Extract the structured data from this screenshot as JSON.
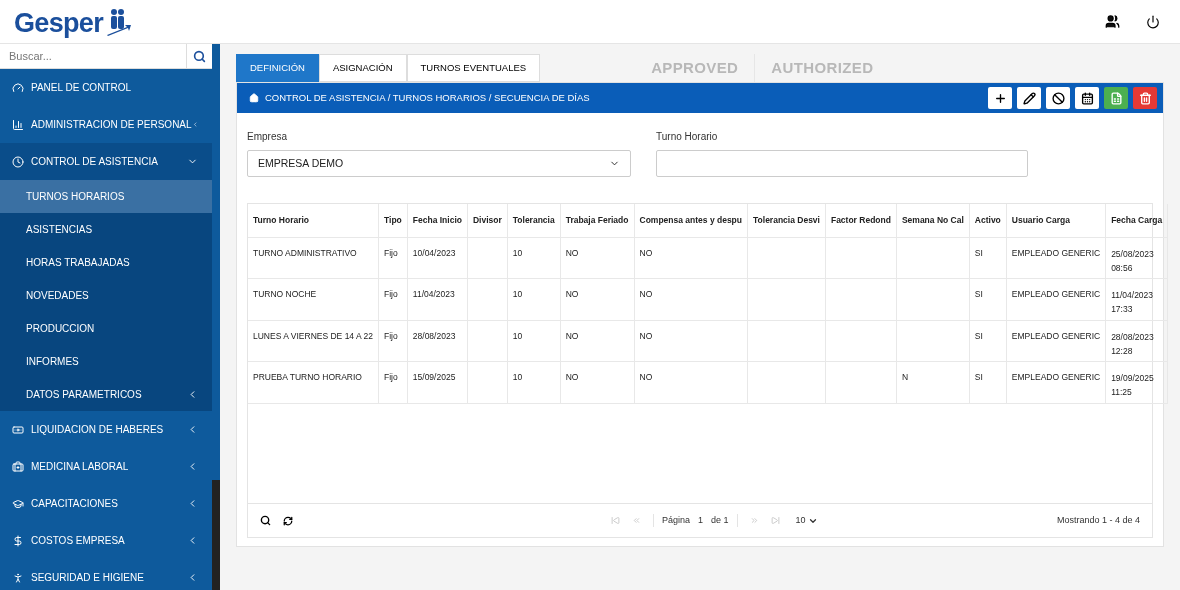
{
  "header": {
    "logo": "Gesper"
  },
  "sidebar": {
    "search": {
      "placeholder": "Buscar..."
    },
    "items": [
      {
        "label": "PANEL DE CONTROL",
        "has_children": false,
        "expanded": false
      },
      {
        "label": "ADMINISTRACION DE PERSONAL",
        "has_children": true,
        "expanded": false
      },
      {
        "label": "CONTROL DE ASISTENCIA",
        "has_children": true,
        "expanded": true,
        "children": [
          {
            "label": "TURNOS HORARIOS",
            "selected": true,
            "has_children": false
          },
          {
            "label": "ASISTENCIAS",
            "selected": false,
            "has_children": false
          },
          {
            "label": "HORAS TRABAJADAS",
            "selected": false,
            "has_children": false
          },
          {
            "label": "NOVEDADES",
            "selected": false,
            "has_children": false
          },
          {
            "label": "PRODUCCION",
            "selected": false,
            "has_children": false
          },
          {
            "label": "INFORMES",
            "selected": false,
            "has_children": false
          },
          {
            "label": "DATOS PARAMETRICOS",
            "selected": false,
            "has_children": true
          }
        ]
      },
      {
        "label": "LIQUIDACION DE HABERES",
        "has_children": true,
        "expanded": false
      },
      {
        "label": "MEDICINA LABORAL",
        "has_children": true,
        "expanded": false
      },
      {
        "label": "CAPACITACIONES",
        "has_children": true,
        "expanded": false
      },
      {
        "label": "COSTOS EMPRESA",
        "has_children": true,
        "expanded": false
      },
      {
        "label": "SEGURIDAD E HIGIENE",
        "has_children": true,
        "expanded": false
      }
    ]
  },
  "tabs": [
    {
      "label": "DEFINICIÓN",
      "selected": true
    },
    {
      "label": "ASIGNACIÓN",
      "selected": false
    },
    {
      "label": "TURNOS EVENTUALES",
      "selected": false
    }
  ],
  "status_labels": [
    "APPROVED",
    "AUTHORIZED"
  ],
  "breadcrumb": "CONTROL DE ASISTENCIA / TURNOS HORARIOS / SECUENCIA DE DÍAS",
  "toolbar": [
    {
      "kind": "add"
    },
    {
      "kind": "edit"
    },
    {
      "kind": "disable"
    },
    {
      "kind": "calendar"
    },
    {
      "kind": "excel"
    },
    {
      "kind": "delete"
    }
  ],
  "form": {
    "empresa": {
      "label": "Empresa",
      "value": "EMPRESA DEMO"
    },
    "turno_horario": {
      "label": "Turno Horario"
    }
  },
  "table": {
    "columns": [
      "Turno Horario",
      "Tipo",
      "Fecha Inicio",
      "Divisor",
      "Tolerancia",
      "Trabaja Feriado",
      "Compensa antes y despu",
      "Tolerancia Desvi",
      "Factor Redond",
      "Semana No Cal",
      "Activo",
      "Usuario Carga",
      "Fecha Carga"
    ],
    "rows": [
      [
        "TURNO ADMINISTRATIVO",
        "Fijo",
        "10/04/2023",
        "",
        "10",
        "NO",
        "NO",
        "",
        "",
        "",
        "SI",
        "EMPLEADO GENERIC",
        "25/08/2023 08:56"
      ],
      [
        "TURNO NOCHE",
        "Fijo",
        "11/04/2023",
        "",
        "10",
        "NO",
        "NO",
        "",
        "",
        "",
        "SI",
        "EMPLEADO GENERIC",
        "11/04/2023 17:33"
      ],
      [
        "LUNES A VIERNES DE 14 A 22",
        "Fijo",
        "28/08/2023",
        "",
        "10",
        "NO",
        "NO",
        "",
        "",
        "",
        "SI",
        "EMPLEADO GENERIC",
        "28/08/2023 12:28"
      ],
      [
        "PRUEBA TURNO HORARIO",
        "Fijo",
        "15/09/2025",
        "",
        "10",
        "NO",
        "NO",
        "",
        "",
        "N",
        "SI",
        "EMPLEADO GENERIC",
        "19/09/2025 11:25"
      ]
    ]
  },
  "pager": {
    "page_label": "Página",
    "page": "1",
    "of": "de 1",
    "page_size": "10",
    "summary": "Mostrando 1 - 4 de 4"
  }
}
